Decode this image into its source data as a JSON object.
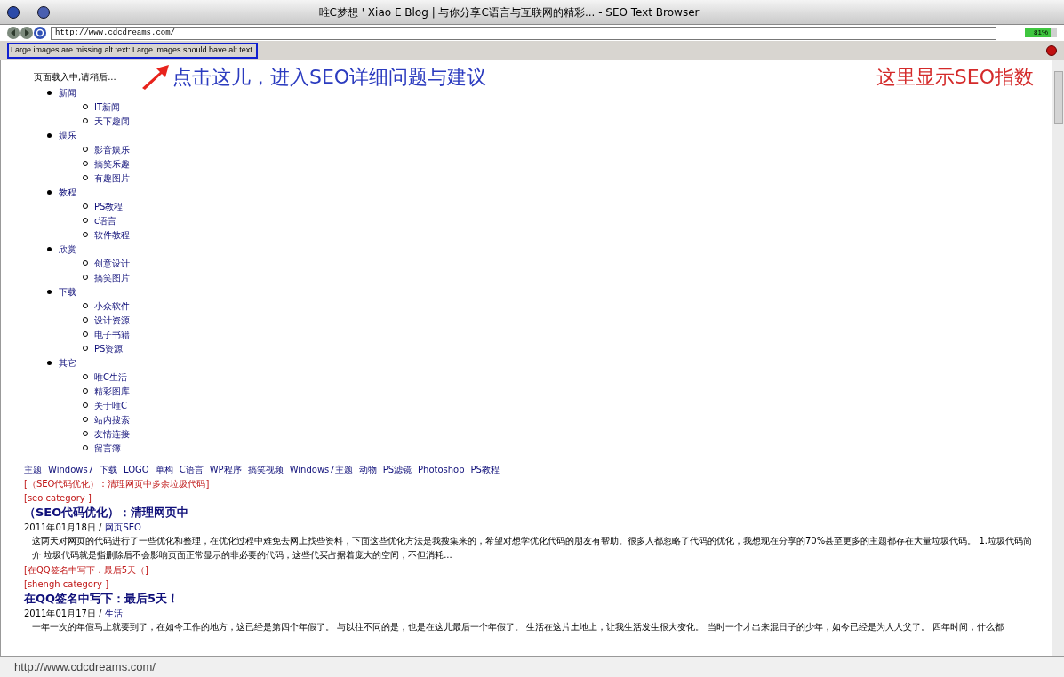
{
  "window": {
    "title": "唯C梦想 ' Xiao E Blog | 与你分享C语言与互联网的精彩... - SEO Text Browser"
  },
  "address": {
    "value": "http://www.cdcdreams.com/"
  },
  "seo_score": {
    "text": "81%",
    "level": 0.81
  },
  "message": "Large images are missing alt text: Large images should have alt text.",
  "annotations": [
    {
      "text": "点击这儿，进入SEO详细问题与建议",
      "color": "#2b3bbf"
    },
    {
      "text": "这里显示SEO指数",
      "color": "#d42a2a"
    }
  ],
  "loading": "页面载入中,请稍后...",
  "menu": [
    {
      "label": "新闻",
      "children": [
        {
          "label": "IT新闻"
        },
        {
          "label": "天下趣闻"
        }
      ]
    },
    {
      "label": "娱乐",
      "children": [
        {
          "label": "影音娱乐"
        },
        {
          "label": "搞笑乐趣"
        },
        {
          "label": "有趣图片"
        }
      ]
    },
    {
      "label": "教程",
      "children": [
        {
          "label": "PS教程"
        },
        {
          "label": "c语言"
        },
        {
          "label": "软件教程"
        }
      ]
    },
    {
      "label": "欣赏",
      "children": [
        {
          "label": "创意设计"
        },
        {
          "label": "搞笑图片"
        }
      ]
    },
    {
      "label": "下载",
      "children": [
        {
          "label": "小众软件"
        },
        {
          "label": "设计资源"
        },
        {
          "label": "电子书籍"
        },
        {
          "label": "PS资源"
        }
      ]
    },
    {
      "label": "其它",
      "children": [
        {
          "label": "唯C生活"
        },
        {
          "label": "精彩图库"
        },
        {
          "label": "关于唯C"
        },
        {
          "label": "站内搜索"
        },
        {
          "label": "友情连接"
        },
        {
          "label": "留言簿"
        }
      ]
    }
  ],
  "tags": [
    "主题",
    "Windows7",
    "下载",
    "LOGO",
    "单构",
    "C语言",
    "WP程序",
    "搞笑视频",
    "Windows7主题",
    "动物",
    "PS滤镜",
    "Photoshop",
    "PS教程"
  ],
  "posts": [
    {
      "link": "[（SEO代码优化）：清理网页中多余垃圾代码]",
      "category": "[seo category ]",
      "title": "（SEO代码优化）：清理网页中",
      "date": "2011年01月18日 /",
      "tag": "网页SEO",
      "body": "这两天对网页的代码进行了一些优化和整理，在优化过程中难免去网上找些资料，下面这些优化方法是我搜集来的，希望对想学优化代码的朋友有帮助。很多人都忽略了代码的优化，我想现在分享的70%甚至更多的主题都存在大量垃圾代码。  1.垃圾代码简介  垃圾代码就是指删除后不会影响页面正常显示的非必要的代码，这些代买占据着庞大的空间，不但消耗..."
    },
    {
      "link": "[在QQ签名中写下：最后5天（]",
      "category": "[shengh category ]",
      "title": "在QQ签名中写下：最后5天！",
      "date": "2011年01月17日 /",
      "tag": "生活",
      "body": "一年一次的年假马上就要到了，在如今工作的地方，这已经是第四个年假了。  与以往不同的是，也是在这儿最后一个年假了。  生活在这片土地上，让我生活发生很大变化。  当时一个才出来混日子的少年，如今已经是为人人父了。  四年时间，什么都"
    }
  ],
  "status_bar": "http://www.cdcdreams.com/"
}
